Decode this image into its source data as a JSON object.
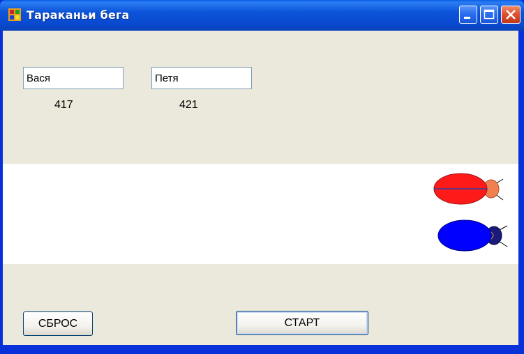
{
  "window": {
    "title": "Тараканьи бега",
    "title_icon": "app-window-icon",
    "controls": [
      "minimize-icon",
      "maximize-icon",
      "close-icon"
    ]
  },
  "players": [
    {
      "name": "Вася",
      "score": "417"
    },
    {
      "name": "Петя",
      "score": "421"
    }
  ],
  "roaches": [
    {
      "color": "#ff1a1a",
      "head_color": "#f08050"
    },
    {
      "color": "#0000ff",
      "head_color": "#1a1a7a"
    }
  ],
  "buttons": {
    "reset_label": "СБРОС",
    "start_label": "СТАРТ"
  },
  "colors": {
    "titlebar": "#0a53d8",
    "client_bg": "#ebe9db",
    "track_bg": "#ffffff"
  }
}
